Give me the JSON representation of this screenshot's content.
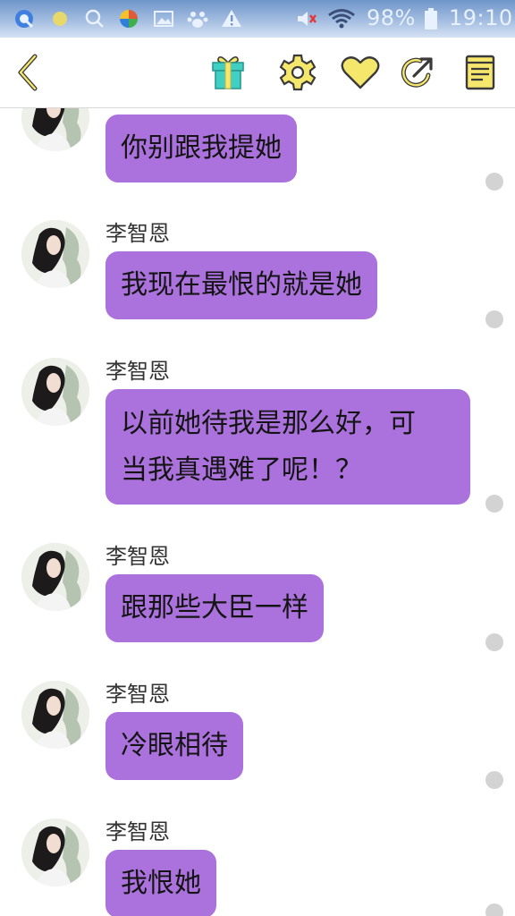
{
  "status_bar": {
    "battery_percent": "98%",
    "time": "19:10",
    "icons": [
      "browser-icon",
      "dot-icon",
      "search-icon",
      "photos-icon",
      "gallery-icon",
      "paw-icon",
      "warning-icon",
      "mute-icon",
      "wifi-icon",
      "battery-icon"
    ]
  },
  "toolbar": {
    "icons": [
      "back-icon",
      "gift-icon",
      "settings-icon",
      "heart-icon",
      "share-icon",
      "notes-icon"
    ],
    "accent_color": "#f5e66c"
  },
  "chat": {
    "bubble_color": "#ab72dd",
    "messages": [
      {
        "sender": "",
        "lines": [
          "你别跟我提她"
        ]
      },
      {
        "sender": "李智恩",
        "lines": [
          "我现在最恨的就是她"
        ]
      },
      {
        "sender": "李智恩",
        "lines": [
          "以前她待我是那么好，可",
          "当我真遇难了呢！？"
        ]
      },
      {
        "sender": "李智恩",
        "lines": [
          "跟那些大臣一样"
        ]
      },
      {
        "sender": "李智恩",
        "lines": [
          "冷眼相待"
        ]
      },
      {
        "sender": "李智恩",
        "lines": [
          "我恨她"
        ]
      }
    ]
  }
}
